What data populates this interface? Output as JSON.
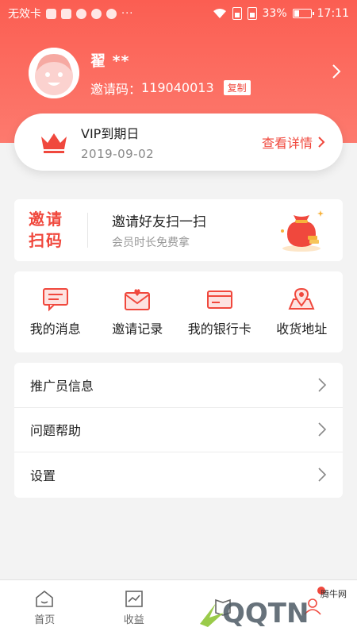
{
  "status_bar": {
    "carrier": "无效卡",
    "dots": "···",
    "battery": "33%",
    "time": "17:11"
  },
  "profile": {
    "name": "翟 **",
    "invite_label": "邀请码：",
    "invite_code": "119040013",
    "copy_label": "复制"
  },
  "vip": {
    "title": "VIP到期日",
    "date": "2019-09-02",
    "detail_label": "查看详情"
  },
  "invite_banner": {
    "tag_line1": "邀请",
    "tag_line2": "扫码",
    "main": "邀请好友扫一扫",
    "sub": "会员时长免费拿"
  },
  "quick_actions": [
    {
      "label": "我的消息",
      "icon": "message-icon"
    },
    {
      "label": "邀请记录",
      "icon": "envelope-heart-icon"
    },
    {
      "label": "我的银行卡",
      "icon": "bank-card-icon"
    },
    {
      "label": "收货地址",
      "icon": "location-map-icon"
    }
  ],
  "menu": [
    {
      "label": "推广员信息"
    },
    {
      "label": "问题帮助"
    },
    {
      "label": "设置"
    }
  ],
  "bottom_nav": [
    {
      "label": "首页",
      "icon": "home-icon"
    },
    {
      "label": "收益",
      "icon": "chart-icon"
    },
    {
      "label": "",
      "icon": "book-icon"
    },
    {
      "label": "",
      "icon": "user-icon"
    }
  ],
  "watermark": {
    "site": "腾牛网",
    "brand": "QQTN"
  },
  "colors": {
    "accent": "#f0483d",
    "header_gradient_top": "#fb5e52",
    "header_gradient_bottom": "#fd7a6e",
    "background": "#f3f3f3"
  }
}
